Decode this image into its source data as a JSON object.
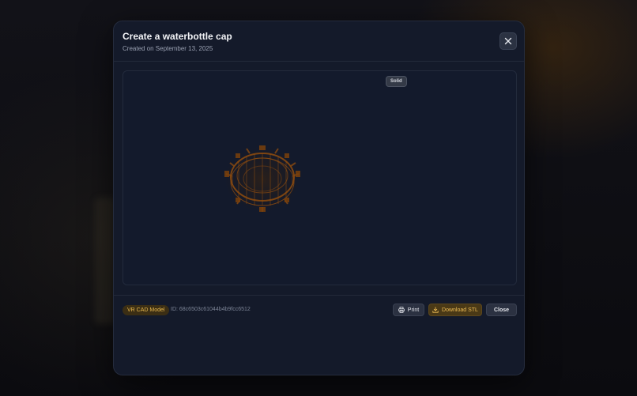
{
  "modal": {
    "title": "Create a waterbottle cap",
    "subtitle": "Created on September 13, 2025",
    "close_icon": "close-icon"
  },
  "viewer": {
    "render_mode_label": "Solid",
    "model_color": "#8a4a10"
  },
  "footer": {
    "badge_label": "VR CAD Model",
    "model_id": "ID: 68c6503c61044b4b9fcc6512",
    "print_label": "Print",
    "print_icon": "printer-icon",
    "download_label": "Download STL",
    "download_icon": "download-icon",
    "close_label": "Close"
  },
  "colors": {
    "modal_bg": "#141a2a",
    "accent": "#e9b94d"
  }
}
